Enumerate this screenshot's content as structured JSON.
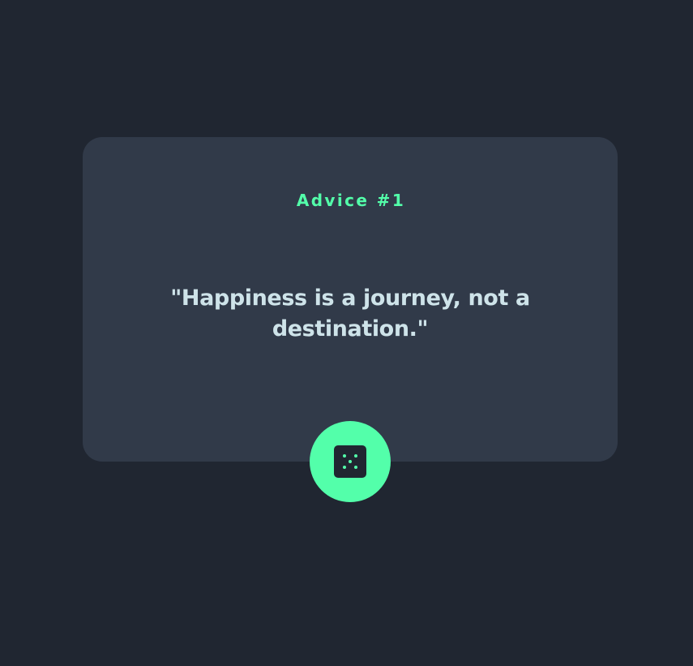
{
  "advice": {
    "label": "Advice #1",
    "text": "\"Happiness is a journey, not a destination.\""
  },
  "controls": {
    "generate_icon": "dice-icon"
  },
  "colors": {
    "background": "#202631",
    "card": "#313a49",
    "accent": "#53ffaa",
    "text": "#cee3e9"
  }
}
